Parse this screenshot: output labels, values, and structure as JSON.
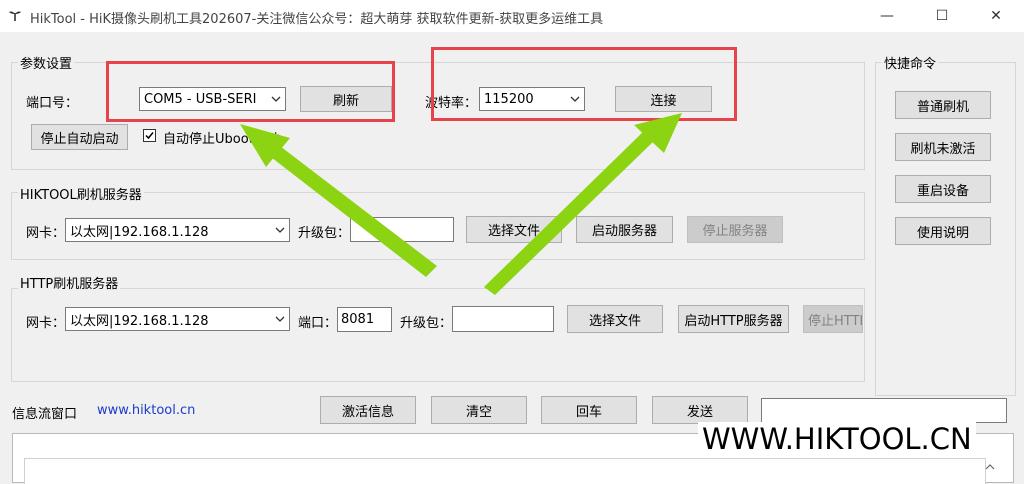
{
  "window": {
    "title": "HikTool - HiK摄像头刷机工具202607-关注微信公众号：超大萌芽 获取软件更新-获取更多运维工具",
    "minimize_glyph": "—",
    "maximize_glyph": "☐",
    "close_glyph": "✕"
  },
  "params": {
    "group_title": "参数设置",
    "port_label": "端口号：",
    "port_value": "COM5 - USB-SERI",
    "refresh_label": "刷新",
    "baud_label": "波特率：",
    "baud_value": "115200",
    "connect_label": "连接",
    "stop_autostart_label": "停止自动启动",
    "auto_stop_uboot_label": "自动停止Uboot启动",
    "auto_stop_uboot_checked": true
  },
  "hiktool_server": {
    "group_title": "HIKTOOL刷机服务器",
    "nic_label": "网卡：",
    "nic_value": "以太网|192.168.1.128",
    "package_label": "升级包：",
    "package_value": "",
    "choose_file_label": "选择文件",
    "start_server_label": "启动服务器",
    "stop_server_label": "停止服务器"
  },
  "http_server": {
    "group_title": "HTTP刷机服务器",
    "nic_label": "网卡：",
    "nic_value": "以太网|192.168.1.128",
    "port_label": "端口：",
    "port_value": "8081",
    "package_label": "升级包：",
    "package_value": "",
    "choose_file_label": "选择文件",
    "start_server_label": "启动HTTP服务器",
    "stop_server_label": "停止HTTP"
  },
  "quick_commands": {
    "group_title": "快捷命令",
    "buttons": [
      "普通刷机",
      "刷机未激活",
      "重启设备",
      "使用说明"
    ]
  },
  "info": {
    "label": "信息流窗口",
    "link": "www.hiktool.cn",
    "buttons": [
      "激活信息",
      "清空",
      "回车",
      "发送"
    ],
    "send_value": ""
  },
  "watermark": "WWW.HIKTOOL.CN",
  "colors": {
    "highlight_box": "#e8424a",
    "arrow": "#8cd312",
    "link": "#1a3bcc"
  }
}
